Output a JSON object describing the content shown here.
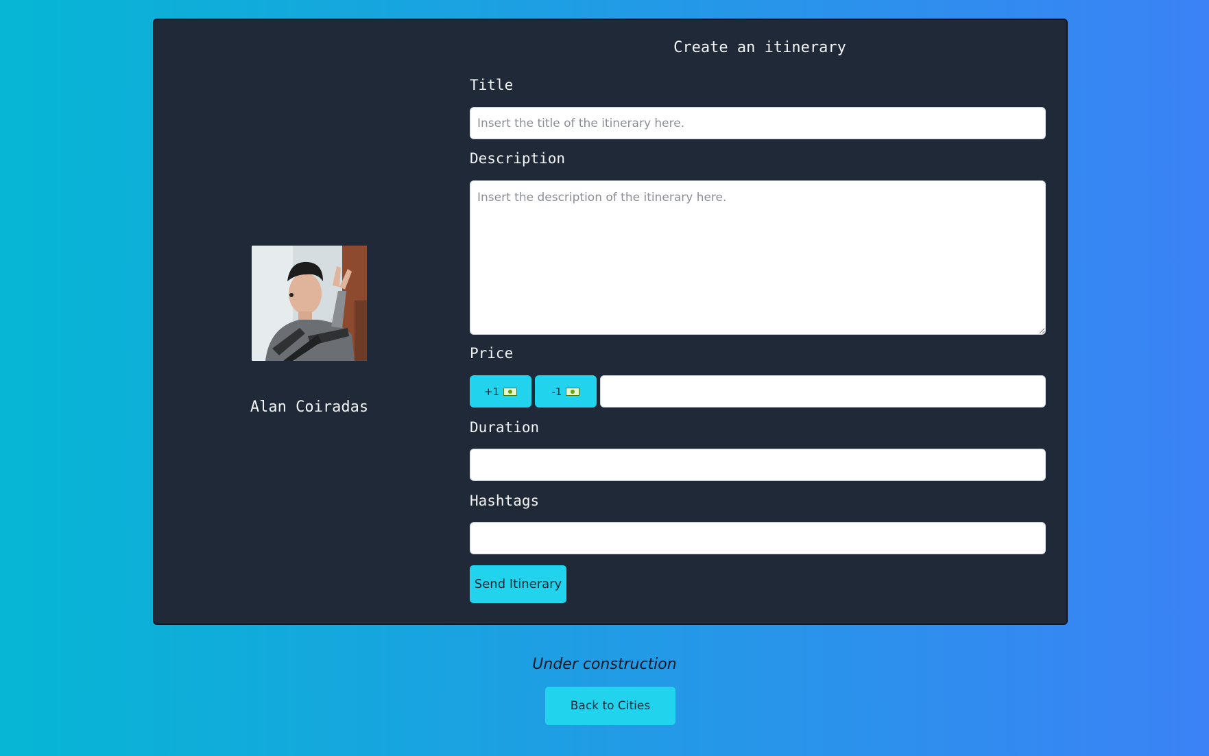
{
  "form": {
    "heading": "Create an itinerary",
    "title_label": "Title",
    "title_placeholder": "Insert the title of the itinerary here.",
    "description_label": "Description",
    "description_placeholder": "Insert the description of the itinerary here.",
    "price_label": "Price",
    "price_increment_label": "+1",
    "price_decrement_label": "-1",
    "price_value": "",
    "duration_label": "Duration",
    "duration_value": "",
    "hashtags_label": "Hashtags",
    "hashtags_value": "",
    "submit_label": "Send Itinerary"
  },
  "profile": {
    "name": "Alan Coiradas"
  },
  "footer": {
    "status_text": "Under construction",
    "back_label": "Back to Cities"
  },
  "colors": {
    "background_start": "#06b6d4",
    "background_end": "#3b82f6",
    "panel": "#1f2937",
    "accent": "#22d3ee"
  },
  "icons": {
    "price_button_icon": "money-bill-icon"
  }
}
